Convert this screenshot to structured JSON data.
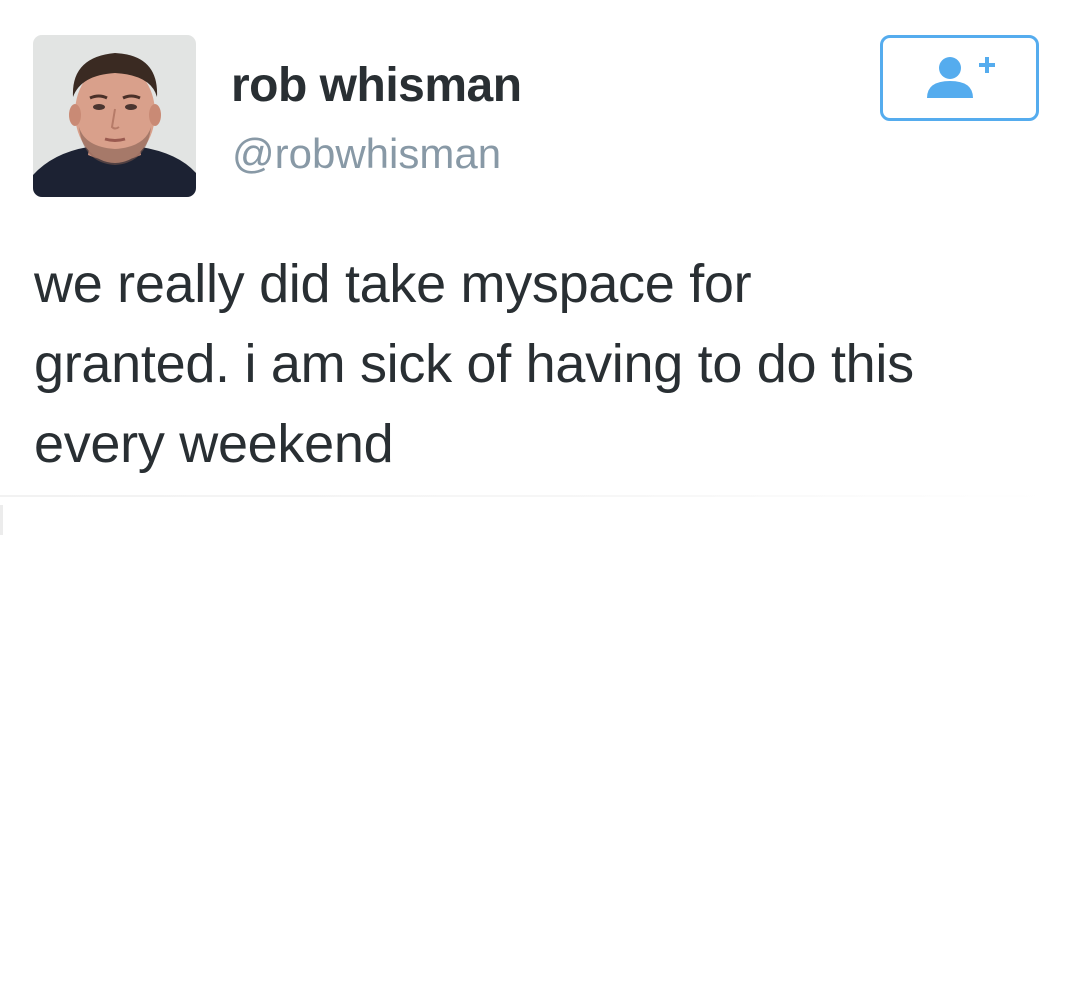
{
  "tweet": {
    "author": {
      "display_name": "rob whisman",
      "handle": "@robwhisman",
      "avatar_icon": "user-photo"
    },
    "follow_button": {
      "icon": "add-user-icon",
      "color": "#55acee"
    },
    "text_lines": [
      "we really did take myspace for",
      "granted. i am sick of having to do this",
      "every weekend"
    ]
  }
}
